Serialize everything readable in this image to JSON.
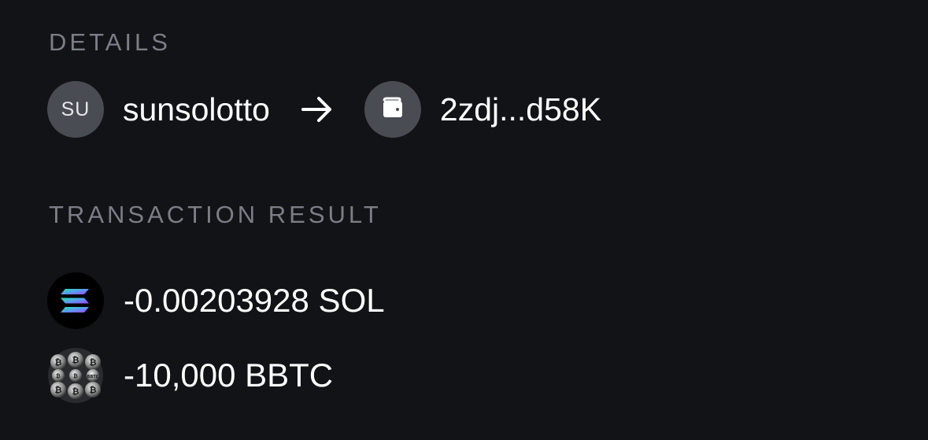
{
  "details": {
    "header": "DETAILS",
    "from": {
      "avatar_initials": "SU",
      "name": "sunsolotto"
    },
    "to": {
      "address": "2zdj...d58K"
    },
    "icons": {
      "arrow": "arrow-right-icon",
      "wallet": "wallet-icon"
    }
  },
  "transaction_result": {
    "header": "TRANSACTION RESULT",
    "items": [
      {
        "token_icon": "solana-icon",
        "amount": "-0.00203928 SOL"
      },
      {
        "token_icon": "bbtc-icon",
        "amount": "-10,000 BBTC"
      }
    ]
  },
  "colors": {
    "background": "#121317",
    "header_text": "#7b7e86",
    "avatar_bg": "#4a4c53",
    "text": "#ffffff"
  }
}
